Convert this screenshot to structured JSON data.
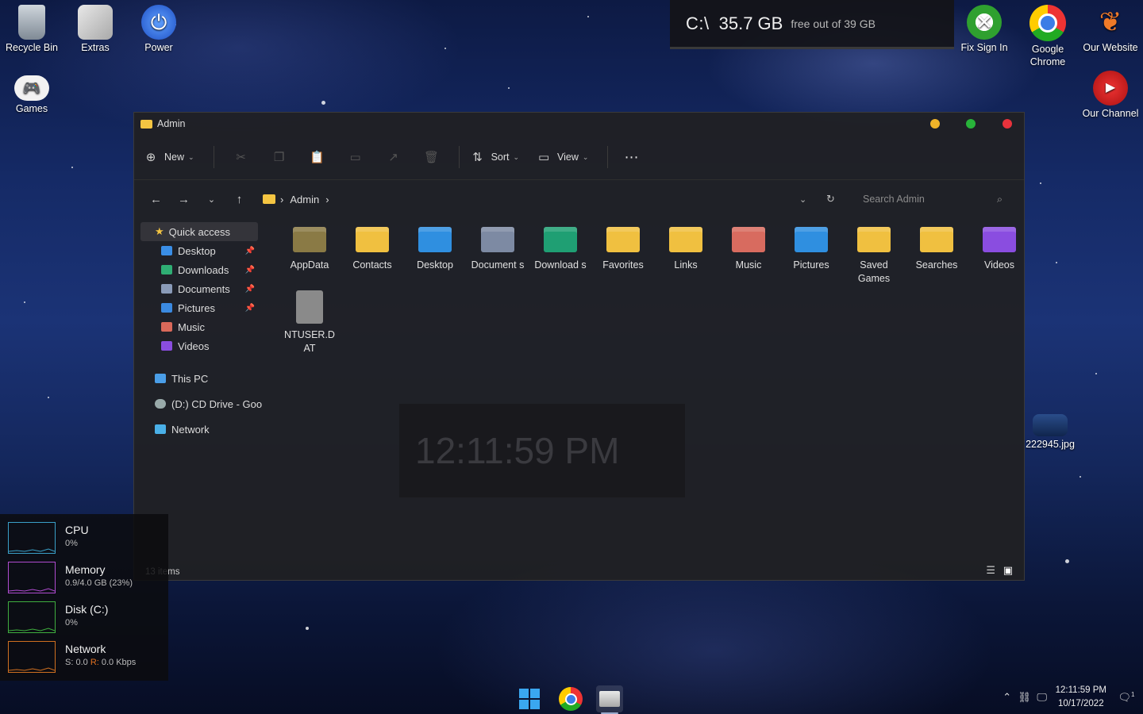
{
  "desktop": {
    "icons": [
      {
        "label": "Recycle Bin",
        "icon": "recycle-bin-icon"
      },
      {
        "label": "Extras",
        "icon": "extras-icon"
      },
      {
        "label": "Power",
        "icon": "power-icon"
      },
      {
        "label": "Games",
        "icon": "gamepad-icon"
      },
      {
        "label": "Fix Sign In",
        "icon": "xbox-icon"
      },
      {
        "label": "Google Chrome",
        "icon": "chrome-icon"
      },
      {
        "label": "Our Website",
        "icon": "website-icon"
      },
      {
        "label": "Our Channel",
        "icon": "youtube-icon"
      }
    ],
    "file_label": "222945.jpg"
  },
  "disk_widget": {
    "drive": "C:\\",
    "free": "35.7 GB",
    "note": "free out of 39 GB"
  },
  "window": {
    "title": "Admin",
    "toolbar": {
      "new_label": "New",
      "sort_label": "Sort",
      "view_label": "View",
      "more": "⋯"
    },
    "breadcrumb": {
      "folder": "Admin",
      "sep": "›"
    },
    "search_placeholder": "Search Admin",
    "nav": {
      "quick_access": "Quick access",
      "items": [
        {
          "label": "Desktop",
          "color": "#3a8ee6",
          "pinned": true
        },
        {
          "label": "Downloads",
          "color": "#2fae74",
          "pinned": true
        },
        {
          "label": "Documents",
          "color": "#8a9bb8",
          "pinned": true
        },
        {
          "label": "Pictures",
          "color": "#3b8ae0",
          "pinned": true
        },
        {
          "label": "Music",
          "color": "#d9695a",
          "pinned": false
        },
        {
          "label": "Videos",
          "color": "#8a4de0",
          "pinned": false
        }
      ],
      "this_pc": "This PC",
      "cd_drive": "(D:) CD Drive - Goo",
      "network": "Network"
    },
    "files": [
      {
        "label": "AppData",
        "color": "#8a7a45"
      },
      {
        "label": "Contacts",
        "color": "#f0c040"
      },
      {
        "label": "Desktop",
        "color": "#2f8fe0"
      },
      {
        "label": "Document s",
        "color": "#7d8aa3"
      },
      {
        "label": "Download s",
        "color": "#1f9f73"
      },
      {
        "label": "Favorites",
        "color": "#f0c040"
      },
      {
        "label": "Links",
        "color": "#f0c040"
      },
      {
        "label": "Music",
        "color": "#d86b5f"
      },
      {
        "label": "Pictures",
        "color": "#2f8fe0"
      },
      {
        "label": "Saved Games",
        "color": "#f0c040"
      },
      {
        "label": "Searches",
        "color": "#f0c040"
      },
      {
        "label": "Videos",
        "color": "#8a4de0"
      },
      {
        "label": "NTUSER.D AT",
        "color": "#8a8a8a"
      }
    ],
    "status": "13 items",
    "ghost_clock": "12:11:59 PM"
  },
  "perf": [
    {
      "name": "CPU",
      "value": "0%",
      "color": "#3aa0c8"
    },
    {
      "name": "Memory",
      "value": "0.9/4.0 GB (23%)",
      "color": "#b04cd0"
    },
    {
      "name": "Disk (C:)",
      "value": "0%",
      "color": "#3fae3f"
    },
    {
      "name": "Network",
      "value_s": "S: 0.0",
      "value_r": "R:",
      "value_rest": " 0.0 Kbps",
      "color": "#d07020"
    }
  ],
  "taskbar": {
    "apps": [
      "start-icon",
      "chrome-icon",
      "file-explorer-icon"
    ],
    "time": "12:11:59 PM",
    "date": "10/17/2022",
    "notifications": "1"
  }
}
